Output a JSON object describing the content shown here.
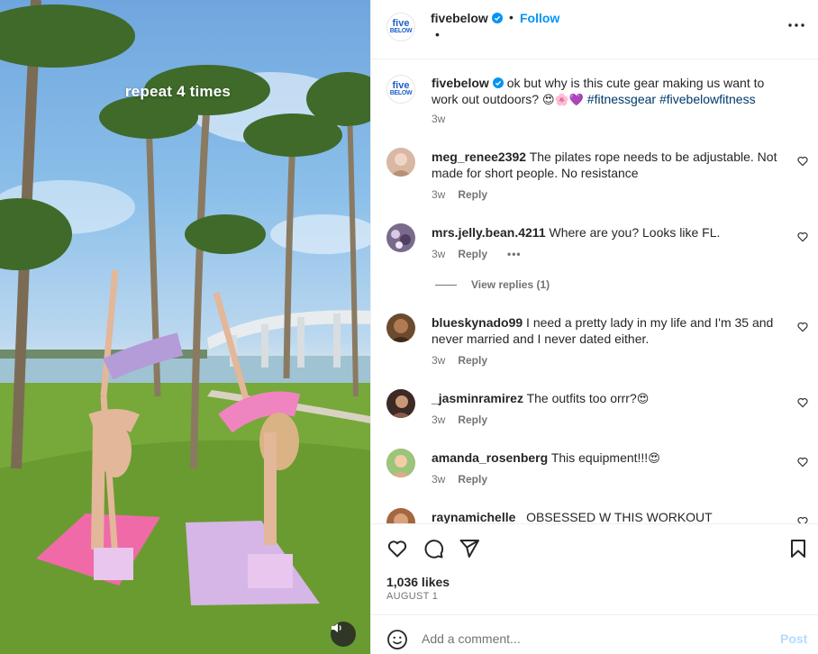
{
  "media": {
    "overlay_text": "repeat 4 times",
    "mute_icon": "speaker-icon"
  },
  "header": {
    "username": "fivebelow",
    "logo_top": "five",
    "logo_bottom": "BELOW",
    "dot": "•",
    "follow_label": "Follow",
    "subline": "•",
    "more_icon": "more-horizontal-icon"
  },
  "caption": {
    "username": "fivebelow",
    "text": "ok but why is this cute gear making us want to work out outdoors?",
    "emojis": "😍🌸💜",
    "hashtags": [
      "#fitnessgear",
      "#fivebelowfitness"
    ],
    "time": "3w"
  },
  "comments": [
    {
      "username": "meg_renee2392",
      "text": "The pilates rope needs to be adjustable. Not made for short people. No resistance",
      "time": "3w",
      "reply": "Reply",
      "avatar_color": "#d8b7a3"
    },
    {
      "username": "mrs.jelly.bean.4211",
      "text": "Where are you? Looks like FL.",
      "time": "3w",
      "reply": "Reply",
      "more": "•••",
      "avatar_color": "#7a6a8c"
    },
    {
      "username": "blueskynado99",
      "text": "I need a pretty lady in my life and I'm 35 and never married and I never dated either.",
      "time": "3w",
      "reply": "Reply",
      "avatar_color": "#6b4a2e"
    },
    {
      "username": "_jasminramirez",
      "text": "The outfits too orrr?",
      "emoji": "😍",
      "time": "3w",
      "reply": "Reply",
      "avatar_color": "#3b2a26"
    },
    {
      "username": "amanda_rosenberg",
      "text": "This equipment!!!",
      "emoji": "😍",
      "time": "3w",
      "reply": "Reply",
      "avatar_color": "#c9a07c"
    },
    {
      "username": "raynamichelle",
      "text": "OBSESSED W THIS WORKOUT",
      "avatar_color": "#a5673f"
    }
  ],
  "view_replies": "View replies (1)",
  "actions": {
    "like_icon": "heart-icon",
    "comment_icon": "comment-icon",
    "share_icon": "share-icon",
    "save_icon": "bookmark-icon",
    "likes": "1,036 likes",
    "date": "AUGUST 1"
  },
  "composer": {
    "placeholder": "Add a comment...",
    "post_label": "Post",
    "emoji_icon": "smiley-icon"
  },
  "colors": {
    "link_blue": "#0095f6",
    "hashtag": "#00376b",
    "muted": "#737373",
    "post_disabled": "#b3dbff"
  }
}
